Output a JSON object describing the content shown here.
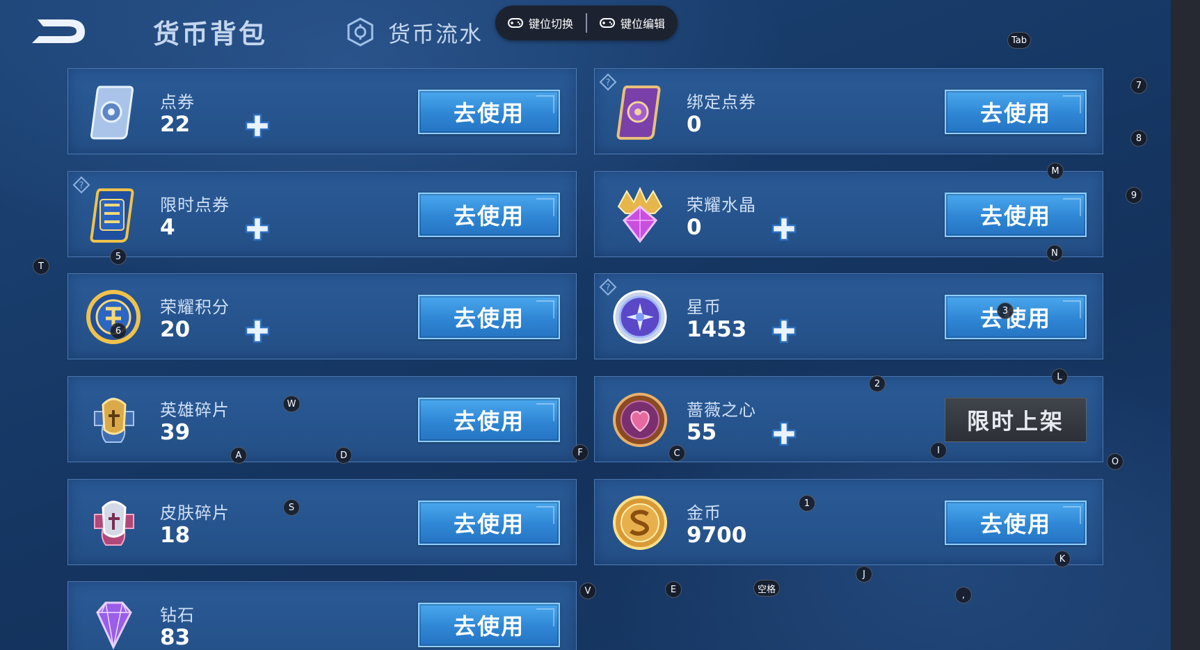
{
  "header": {
    "title": "货币背包",
    "flow_tab": "货币流水"
  },
  "toolbar": {
    "switch_label": "键位切换",
    "edit_label": "键位编辑"
  },
  "currencies": [
    {
      "name": "点券",
      "value": "22",
      "action": "去使用",
      "has_plus": true,
      "has_help": false,
      "icon": "ticket-icon"
    },
    {
      "name": "绑定点券",
      "value": "0",
      "action": "去使用",
      "has_plus": false,
      "has_help": true,
      "icon": "bound-ticket-icon"
    },
    {
      "name": "限时点券",
      "value": "4",
      "action": "去使用",
      "has_plus": true,
      "has_help": true,
      "icon": "limited-ticket-icon"
    },
    {
      "name": "荣耀水晶",
      "value": "0",
      "action": "去使用",
      "has_plus": true,
      "has_help": false,
      "icon": "glory-crystal-icon"
    },
    {
      "name": "荣耀积分",
      "value": "20",
      "action": "去使用",
      "has_plus": true,
      "has_help": false,
      "icon": "glory-points-icon"
    },
    {
      "name": "星币",
      "value": "1453",
      "action": "去使用",
      "has_plus": true,
      "has_help": true,
      "icon": "star-coin-icon"
    },
    {
      "name": "英雄碎片",
      "value": "39",
      "action": "去使用",
      "has_plus": false,
      "has_help": false,
      "icon": "hero-fragment-icon"
    },
    {
      "name": "蔷薇之心",
      "value": "55",
      "action": "限时上架",
      "has_plus": true,
      "has_help": false,
      "icon": "rose-heart-icon"
    },
    {
      "name": "皮肤碎片",
      "value": "18",
      "action": "去使用",
      "has_plus": false,
      "has_help": false,
      "icon": "skin-fragment-icon"
    },
    {
      "name": "金币",
      "value": "9700",
      "action": "去使用",
      "has_plus": false,
      "has_help": false,
      "icon": "gold-coin-icon"
    },
    {
      "name": "钻石",
      "value": "83",
      "action": "去使用",
      "has_plus": false,
      "has_help": false,
      "icon": "diamond-icon"
    }
  ],
  "key_badges": [
    "Tab",
    "7",
    "8",
    "M",
    "9",
    "N",
    "T",
    "5",
    "6",
    "3",
    "2",
    "L",
    "W",
    "A",
    "D",
    "F",
    "C",
    "I",
    "O",
    "S",
    "1",
    "K",
    "J",
    "V",
    "E",
    "空格",
    ","
  ],
  "colors": {
    "background": "#173a68",
    "card": "#2a5a96",
    "button": "#2f86d4",
    "limited_button": "#2c3036"
  }
}
